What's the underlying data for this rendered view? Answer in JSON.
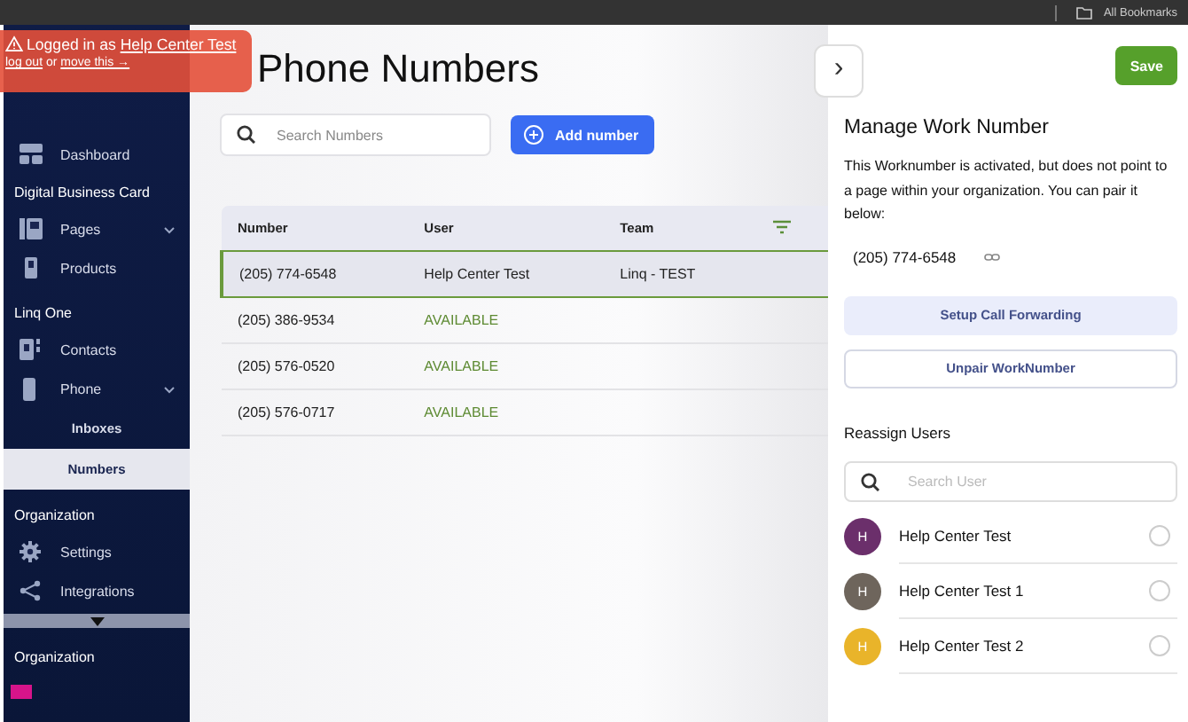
{
  "browser": {
    "bookmarks": "All Bookmarks"
  },
  "banner": {
    "prefix": "Logged in as ",
    "user": "Help Center Test",
    "logout": "log out",
    "middle": " or ",
    "move": "move this →"
  },
  "sidebar": {
    "items": [
      {
        "kind": "item",
        "label": "Dashboard",
        "selected": false
      },
      {
        "kind": "section",
        "label": "Digital Business Card"
      },
      {
        "kind": "group",
        "label": "Pages",
        "selected": false
      },
      {
        "kind": "item",
        "label": "Products",
        "selected": false
      },
      {
        "kind": "section",
        "label": "Linq One"
      },
      {
        "kind": "item",
        "label": "Contacts",
        "selected": false
      },
      {
        "kind": "group",
        "label": "Phone",
        "selected": false,
        "children": [
          {
            "label": "Inboxes",
            "selected": false
          },
          {
            "label": "Numbers",
            "selected": true
          }
        ]
      },
      {
        "kind": "section",
        "label": "Organization"
      },
      {
        "kind": "item",
        "label": "Settings",
        "selected": false
      },
      {
        "kind": "item",
        "label": "Integrations",
        "selected": false
      },
      {
        "kind": "scroll"
      },
      {
        "kind": "section",
        "label": "Organization"
      }
    ]
  },
  "main": {
    "title": "Phone Numbers",
    "search": {
      "placeholder": "Search Numbers"
    },
    "add_button": "Add number",
    "table": {
      "columns": [
        "Number",
        "User",
        "Team"
      ],
      "rows": [
        {
          "number": "(205) 774-6548",
          "user": "Help Center Test",
          "team": "Linq - TEST",
          "available": false,
          "selected": true
        },
        {
          "number": "(205) 386-9534",
          "user": "AVAILABLE",
          "available": true,
          "selected": false
        },
        {
          "number": "(205) 576-0520",
          "user": "AVAILABLE",
          "available": true,
          "selected": false
        },
        {
          "number": "(205) 576-0717",
          "user": "AVAILABLE",
          "available": true,
          "selected": false
        }
      ]
    }
  },
  "panel": {
    "collapse": "›",
    "save": "Save",
    "title": "Manage Work Number",
    "description": "This Worknumber is activated, but does not point to a page within your organization. You can pair it below:",
    "number": "(205) 774-6548",
    "actions": [
      {
        "label": "Setup Call Forwarding",
        "kind": "filled"
      },
      {
        "label": "Unpair WorkNumber",
        "kind": "outlined"
      }
    ],
    "reassign_title": "Reassign Users",
    "search": {
      "placeholder": "Search User"
    },
    "users": [
      {
        "initial": "H",
        "name": "Help Center Test",
        "color": "#6b2f6b",
        "selected": false
      },
      {
        "initial": "H",
        "name": "Help Center Test 1",
        "color": "#6e655c",
        "selected": false
      },
      {
        "initial": "H",
        "name": "Help Center Test 2",
        "color": "#e9b42a",
        "selected": false
      }
    ]
  }
}
